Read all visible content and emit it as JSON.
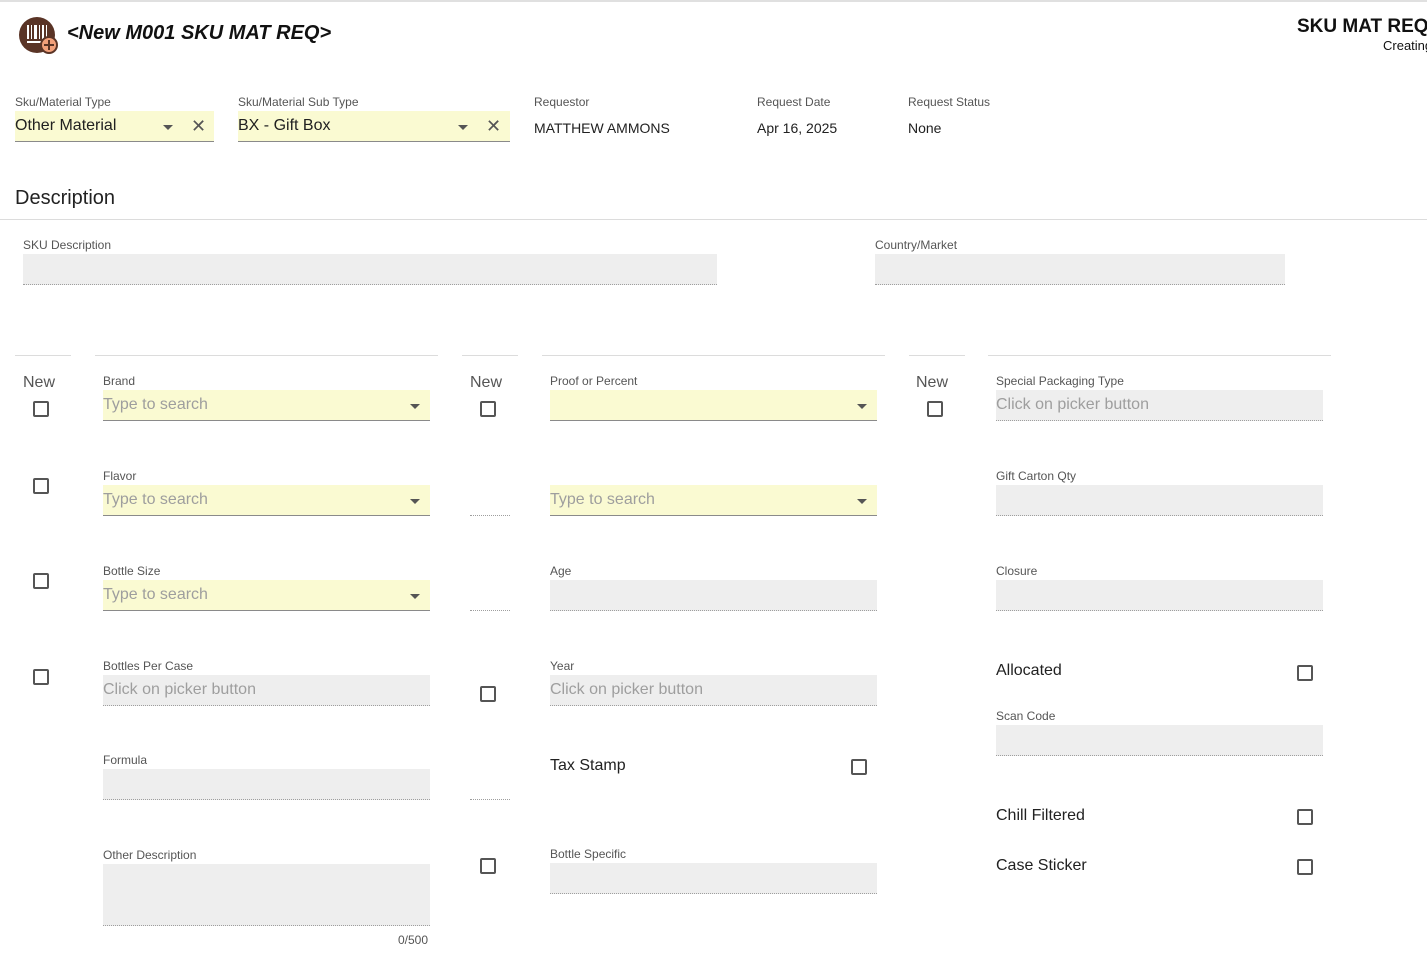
{
  "app": {
    "title": "<New M001 SKU MAT REQ>",
    "header_right_title": "SKU MAT REQS",
    "header_right_subtitle": "Creating"
  },
  "top": {
    "type_label": "Sku/Material Type",
    "type_value": "Other Material",
    "subtype_label": "Sku/Material Sub Type",
    "subtype_value": "BX - Gift Box",
    "requestor_label": "Requestor",
    "requestor_value": "MATTHEW AMMONS",
    "request_date_label": "Request Date",
    "request_date_value": "Apr 16, 2025",
    "request_status_label": "Request Status",
    "request_status_value": "None"
  },
  "description": {
    "section_title": "Description",
    "sku_desc_label": "SKU Description",
    "country_label": "Country/Market"
  },
  "col1": {
    "new_label": "New",
    "brand_label": "Brand",
    "brand_placeholder": "Type to search",
    "flavor_label": "Flavor",
    "flavor_placeholder": "Type to search",
    "bottle_size_label": "Bottle Size",
    "bottle_size_placeholder": "Type to search",
    "bottles_per_case_label": "Bottles Per Case",
    "bottles_per_case_placeholder": "Click on picker button",
    "formula_label": "Formula",
    "other_desc_label": "Other Description",
    "other_desc_counter": "0/500"
  },
  "col2": {
    "new_label": "New",
    "proof_label": "Proof or Percent",
    "second_placeholder": "Type to search",
    "age_label": "Age",
    "year_label": "Year",
    "year_placeholder": "Click on picker button",
    "tax_stamp_label": "Tax Stamp",
    "bottle_specific_label": "Bottle Specific"
  },
  "col3": {
    "new_label": "New",
    "special_pkg_label": "Special Packaging Type",
    "special_pkg_placeholder": "Click on picker button",
    "gift_carton_label": "Gift Carton Qty",
    "closure_label": "Closure",
    "allocated_label": "Allocated",
    "scan_code_label": "Scan Code",
    "chill_filtered_label": "Chill Filtered",
    "case_sticker_label": "Case Sticker"
  },
  "colors": {
    "required_bg": "#fafad2",
    "readonly_bg": "#eeeeee",
    "app_icon_fill": "#5a3426"
  }
}
